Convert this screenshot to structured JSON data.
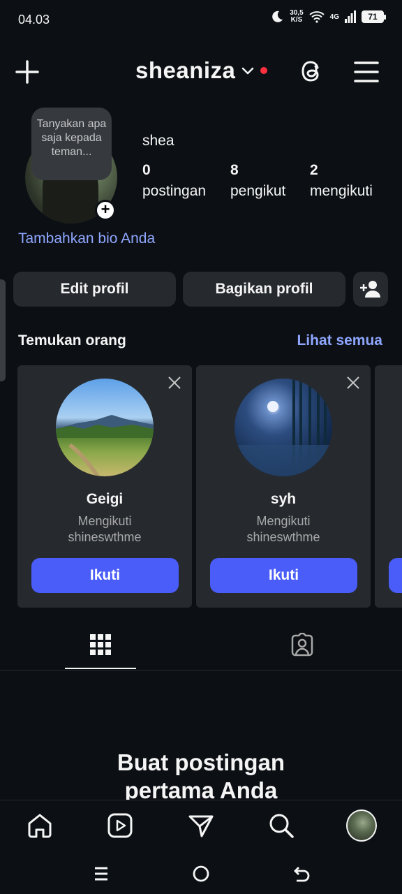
{
  "status_bar": {
    "time": "04.03",
    "speed_value": "30,5",
    "speed_unit": "K/S",
    "network": "4G",
    "battery": "71"
  },
  "header": {
    "username": "sheaniza",
    "icons": [
      "plus-icon",
      "chevron-down-icon",
      "threads-icon",
      "menu-icon"
    ]
  },
  "profile": {
    "note": "Tanyakan apa saja kepada teman...",
    "display_name": "shea",
    "stats": [
      {
        "value": "0",
        "label": "postingan"
      },
      {
        "value": "8",
        "label": "pengikut"
      },
      {
        "value": "2",
        "label": "mengikuti"
      }
    ],
    "bio_link": "Tambahkan bio Anda"
  },
  "actions": {
    "edit": "Edit profil",
    "share": "Bagikan profil"
  },
  "discover": {
    "title": "Temukan orang",
    "see_all": "Lihat semua",
    "cards": [
      {
        "name": "Geigi",
        "sub1": "Mengikuti",
        "sub2": "shineswthme",
        "button": "Ikuti"
      },
      {
        "name": "syh",
        "sub1": "Mengikuti",
        "sub2": "shineswthme",
        "button": "Ikuti"
      }
    ]
  },
  "empty_state": {
    "title": "Buat postingan pertama Anda"
  },
  "colors": {
    "background": "#0c1014",
    "surface": "#262a2f",
    "accent": "#4a5df9",
    "link": "#8fa6ff",
    "notification": "#ff3040"
  }
}
